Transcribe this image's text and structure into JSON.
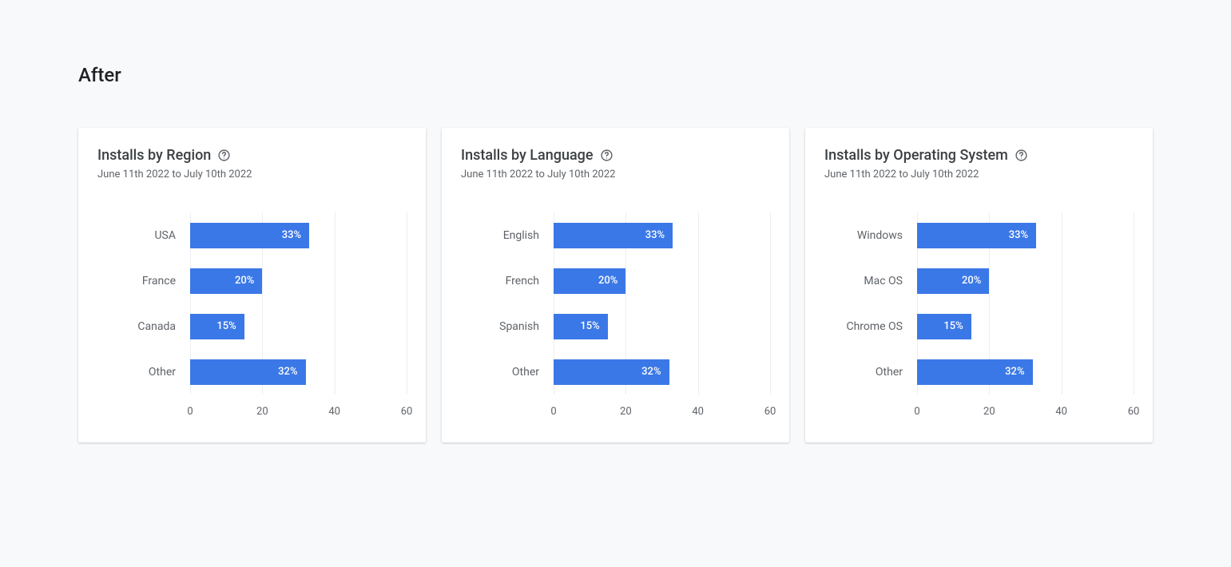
{
  "page_title": "After",
  "date_range": "June 11th 2022 to July 10th 2022",
  "axis": {
    "max": 60,
    "ticks": [
      0,
      20,
      40,
      60
    ]
  },
  "cards": [
    {
      "title": "Installs by Region",
      "rows": [
        {
          "label": "USA",
          "value": 33,
          "pct": "33%"
        },
        {
          "label": "France",
          "value": 20,
          "pct": "20%"
        },
        {
          "label": "Canada",
          "value": 15,
          "pct": "15%"
        },
        {
          "label": "Other",
          "value": 32,
          "pct": "32%"
        }
      ]
    },
    {
      "title": "Installs by Language",
      "rows": [
        {
          "label": "English",
          "value": 33,
          "pct": "33%"
        },
        {
          "label": "French",
          "value": 20,
          "pct": "20%"
        },
        {
          "label": "Spanish",
          "value": 15,
          "pct": "15%"
        },
        {
          "label": "Other",
          "value": 32,
          "pct": "32%"
        }
      ]
    },
    {
      "title": "Installs by Operating System",
      "rows": [
        {
          "label": "Windows",
          "value": 33,
          "pct": "33%"
        },
        {
          "label": "Mac OS",
          "value": 20,
          "pct": "20%"
        },
        {
          "label": "Chrome OS",
          "value": 15,
          "pct": "15%"
        },
        {
          "label": "Other",
          "value": 32,
          "pct": "32%"
        }
      ]
    }
  ],
  "chart_data": [
    {
      "type": "bar",
      "title": "Installs by Region",
      "subtitle": "June 11th 2022 to July 10th 2022",
      "categories": [
        "USA",
        "France",
        "Canada",
        "Other"
      ],
      "values": [
        33,
        20,
        15,
        32
      ],
      "xlabel": "",
      "ylabel": "",
      "xlim": [
        0,
        60
      ],
      "xticks": [
        0,
        20,
        40,
        60
      ]
    },
    {
      "type": "bar",
      "title": "Installs by Language",
      "subtitle": "June 11th 2022 to July 10th 2022",
      "categories": [
        "English",
        "French",
        "Spanish",
        "Other"
      ],
      "values": [
        33,
        20,
        15,
        32
      ],
      "xlabel": "",
      "ylabel": "",
      "xlim": [
        0,
        60
      ],
      "xticks": [
        0,
        20,
        40,
        60
      ]
    },
    {
      "type": "bar",
      "title": "Installs by Operating System",
      "subtitle": "June 11th 2022 to July 10th 2022",
      "categories": [
        "Windows",
        "Mac OS",
        "Chrome OS",
        "Other"
      ],
      "values": [
        33,
        20,
        15,
        32
      ],
      "xlabel": "",
      "ylabel": "",
      "xlim": [
        0,
        60
      ],
      "xticks": [
        0,
        20,
        40,
        60
      ]
    }
  ]
}
